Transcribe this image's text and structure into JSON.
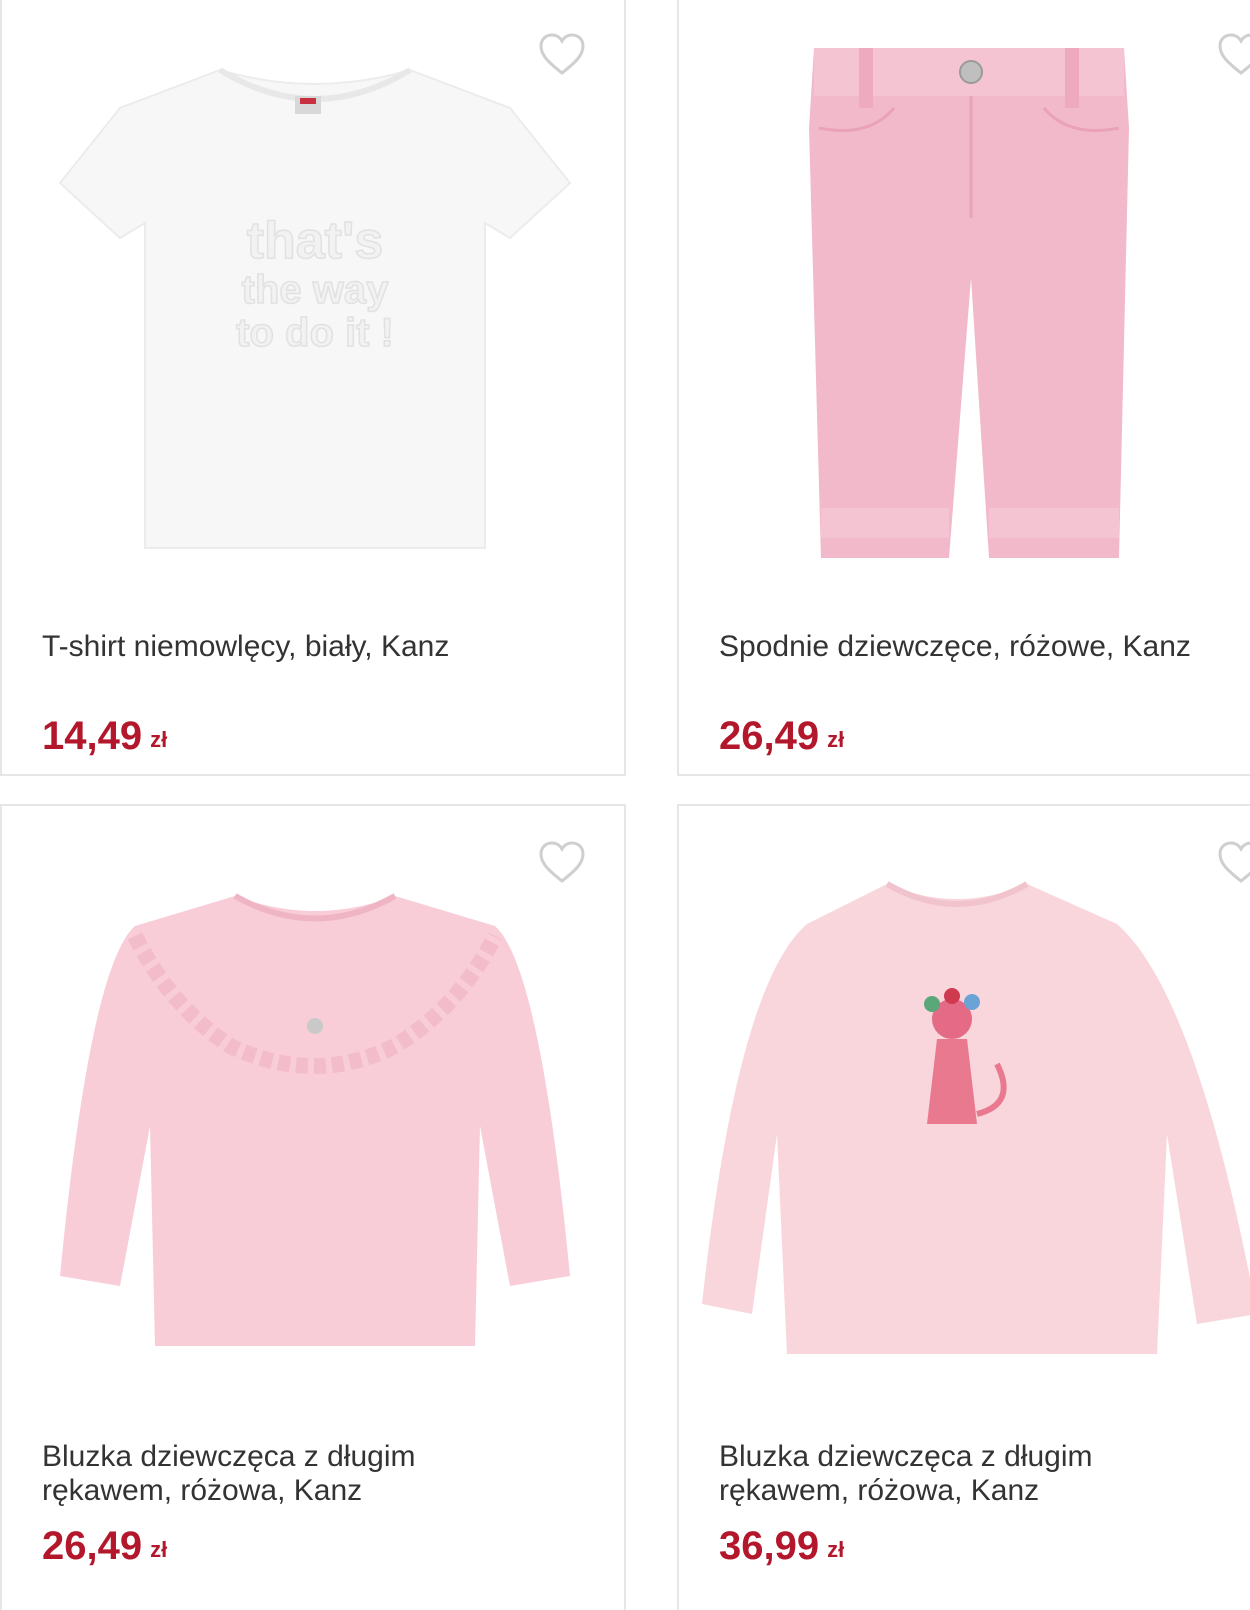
{
  "products": [
    {
      "title": "T-shirt niemowlęcy, biały, Kanz",
      "price": "14,49",
      "currency": "zł",
      "image": "white-tshirt",
      "print_text": "that's the way to do it !"
    },
    {
      "title": "Spodnie dziewczęce, różowe, Kanz",
      "price": "26,49",
      "currency": "zł",
      "image": "pink-pants"
    },
    {
      "title": "Bluzka dziewczęca z długim\nrękawem, różowa, Kanz",
      "price": "26,49",
      "currency": "zł",
      "image": "pink-ruffle-blouse"
    },
    {
      "title": "Bluzka dziewczęca z długim\nrękawem, różowa, Kanz",
      "price": "36,99",
      "currency": "zł",
      "image": "pink-cat-blouse"
    }
  ],
  "icons": {
    "favorite": "heart-outline-icon"
  },
  "colors": {
    "price": "#b3172b",
    "title": "#333333",
    "border": "#e6e6e6",
    "heart": "#cfcfcf"
  }
}
